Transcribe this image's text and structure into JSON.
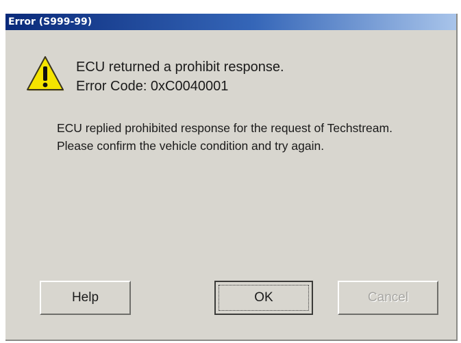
{
  "dialog": {
    "title": "Error (S999-99)",
    "headline_line1": "ECU returned a prohibit response.",
    "headline_line2": "Error Code: 0xC0040001",
    "message": "ECU replied prohibited response for the request of Techstream. Please confirm the vehicle condition and try again.",
    "icon": "warning-icon"
  },
  "buttons": {
    "help_label": "Help",
    "ok_label": "OK",
    "cancel_label": "Cancel",
    "cancel_state": "disabled"
  },
  "colors": {
    "titlebar_start": "#0a2a7a",
    "titlebar_end": "#a8c4ea",
    "dialog_background": "#d8d6cf",
    "warning_yellow": "#f5e400"
  }
}
